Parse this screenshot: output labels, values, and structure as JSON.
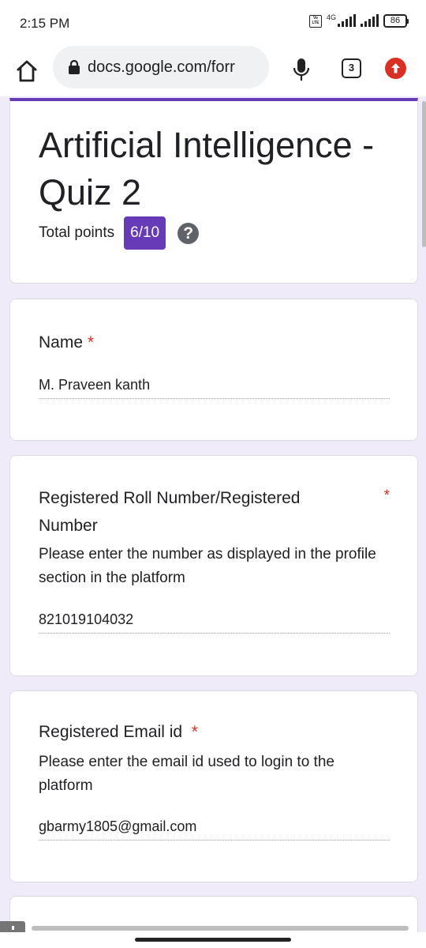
{
  "status_bar": {
    "time": "2:15 PM",
    "volte": "Vo LTE",
    "network": "4G",
    "battery": "86"
  },
  "browser": {
    "url": "docs.google.com/forr",
    "tab_count": "3"
  },
  "form": {
    "title": "Artificial Intelligence - Quiz 2",
    "points_label": "Total points",
    "points_value": "6/10",
    "help": "?",
    "accent_color": "#673ab7"
  },
  "questions": [
    {
      "title": "Name",
      "required": "*",
      "description": "",
      "answer": "M. Praveen kanth"
    },
    {
      "title": "Registered Roll Number/Registered Number",
      "required": "*",
      "description": "Please enter the number as displayed in the profile section in the platform",
      "answer": "821019104032"
    },
    {
      "title": "Registered Email id",
      "required": "*",
      "description": "Please enter the email id used to login to the platform",
      "answer": "gbarmy1805@gmail.com"
    }
  ]
}
